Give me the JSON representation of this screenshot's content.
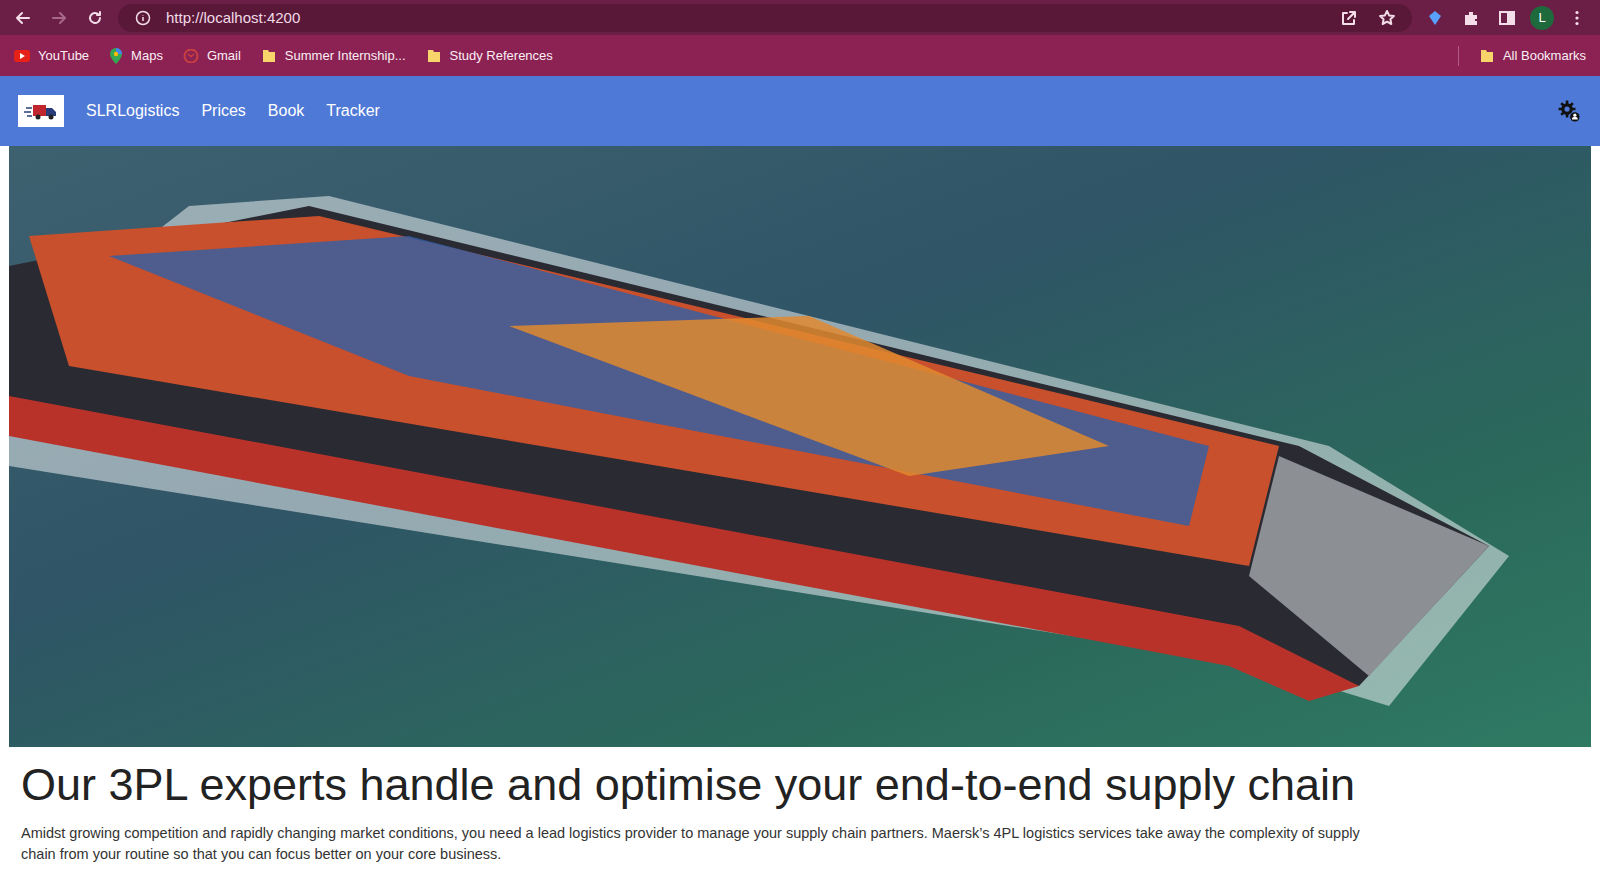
{
  "browser": {
    "url": "http://localhost:4200",
    "profile": "L"
  },
  "bookmarks": [
    {
      "label": "YouTube",
      "kind": "youtube"
    },
    {
      "label": "Maps",
      "kind": "maps"
    },
    {
      "label": "Gmail",
      "kind": "gmail"
    },
    {
      "label": "Summer Internship...",
      "kind": "folder"
    },
    {
      "label": "Study References",
      "kind": "folder"
    }
  ],
  "all_bookmarks": "All Bookmarks",
  "navbar": {
    "brand": "SLRLogistics",
    "links": [
      "Prices",
      "Book",
      "Tracker"
    ]
  },
  "hero": {
    "heading": "Our 3PL experts handle and optimise your end-to-end supply chain",
    "text": "Amidst growing competition and rapidly changing market conditions, you need a lead logistics provider to manage your supply chain partners. Maersk’s 4PL logistics services take away the complexity of supply chain from your routine so that you can focus better on your core business."
  }
}
